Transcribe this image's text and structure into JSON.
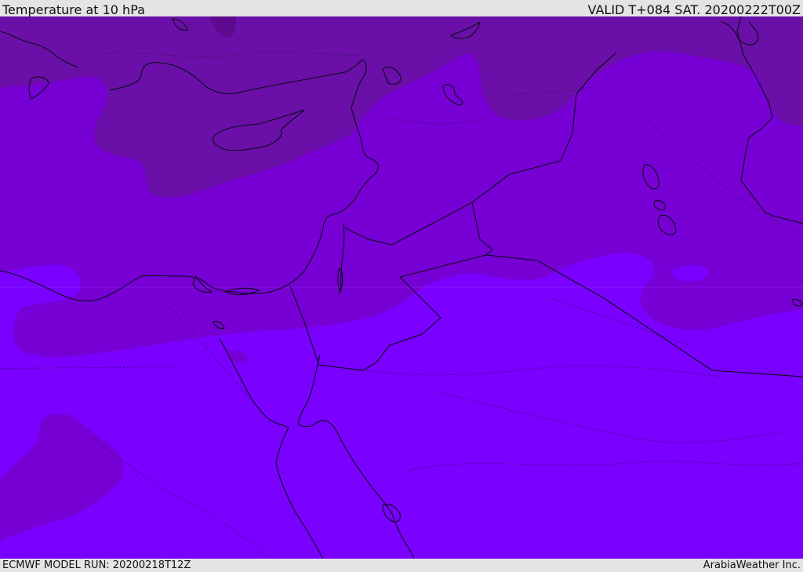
{
  "header": {
    "title": "Temperature at 10 hPa",
    "valid": "VALID T+084 SAT. 20200222T00Z"
  },
  "footer": {
    "model_run": "ECMWF MODEL RUN: 20200218T12Z",
    "credit": "ArabiaWeather Inc."
  },
  "map": {
    "field": "Temperature at 10 hPa",
    "colors": {
      "band_cold": "#6a10a8",
      "band_mid": "#7700d4",
      "band_warm": "#7a00ff",
      "band_dark_spot": "#5c0a8e",
      "coastline": "#0a0a18",
      "graticule": "#b07cff"
    }
  }
}
